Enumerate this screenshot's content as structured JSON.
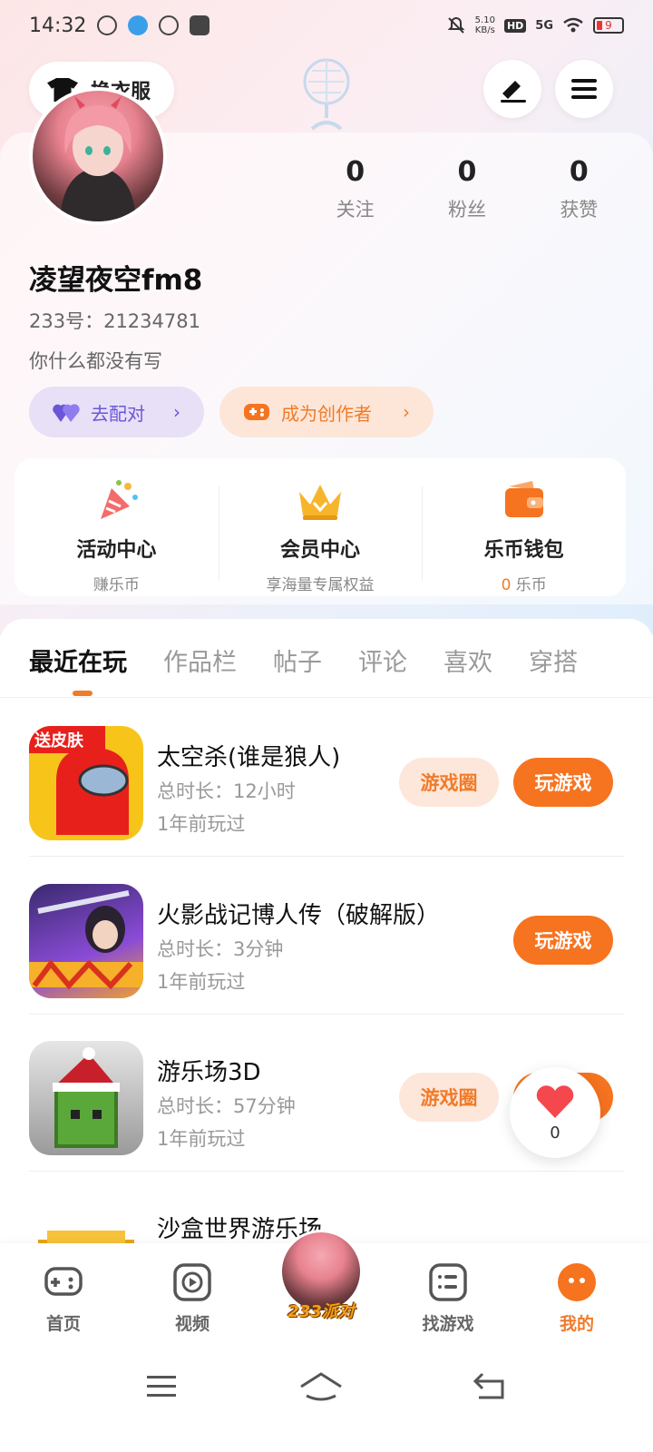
{
  "status_bar": {
    "time": "14:32",
    "net_speed": "5.10",
    "net_unit": "KB/s",
    "hd": "HD",
    "signal": "5G",
    "battery": "9"
  },
  "header": {
    "costume_label": "换衣服"
  },
  "profile": {
    "username": "凌望夜空fm8",
    "uid_label": "233号：21234781",
    "bio": "你什么都没有写",
    "stats": [
      {
        "value": "0",
        "label": "关注"
      },
      {
        "value": "0",
        "label": "粉丝"
      },
      {
        "value": "0",
        "label": "获赞"
      }
    ],
    "match_label": "去配对",
    "creator_label": "成为创作者"
  },
  "features": [
    {
      "title": "活动中心",
      "sub": "赚乐币"
    },
    {
      "title": "会员中心",
      "sub": "享海量专属权益"
    },
    {
      "title": "乐币钱包",
      "coin_value": "0",
      "sub": " 乐币"
    }
  ],
  "tabs": [
    "最近在玩",
    "作品栏",
    "帖子",
    "评论",
    "喜欢",
    "穿搭"
  ],
  "games": [
    {
      "name": "太空杀(谁是狼人)",
      "duration": "总时长：12小时",
      "last": "1年前玩过",
      "circle_label": "游戏圈",
      "play_label": "玩游戏",
      "badge": "送皮肤"
    },
    {
      "name": "火影战记博人传（破解版）",
      "duration": "总时长：3分钟",
      "last": "1年前玩过",
      "play_label": "玩游戏"
    },
    {
      "name": "游乐场3D",
      "duration": "总时长：57分钟",
      "last": "1年前玩过",
      "circle_label": "游戏圈",
      "play_label": "玩游戏"
    },
    {
      "name": "沙盒世界游乐场"
    }
  ],
  "floating_like": {
    "count": "0"
  },
  "bottom_nav": {
    "home": "首页",
    "video": "视频",
    "party": "233派对",
    "find": "找游戏",
    "mine": "我的"
  },
  "colors": {
    "accent": "#f6731f",
    "purple": "#6b56d8"
  }
}
